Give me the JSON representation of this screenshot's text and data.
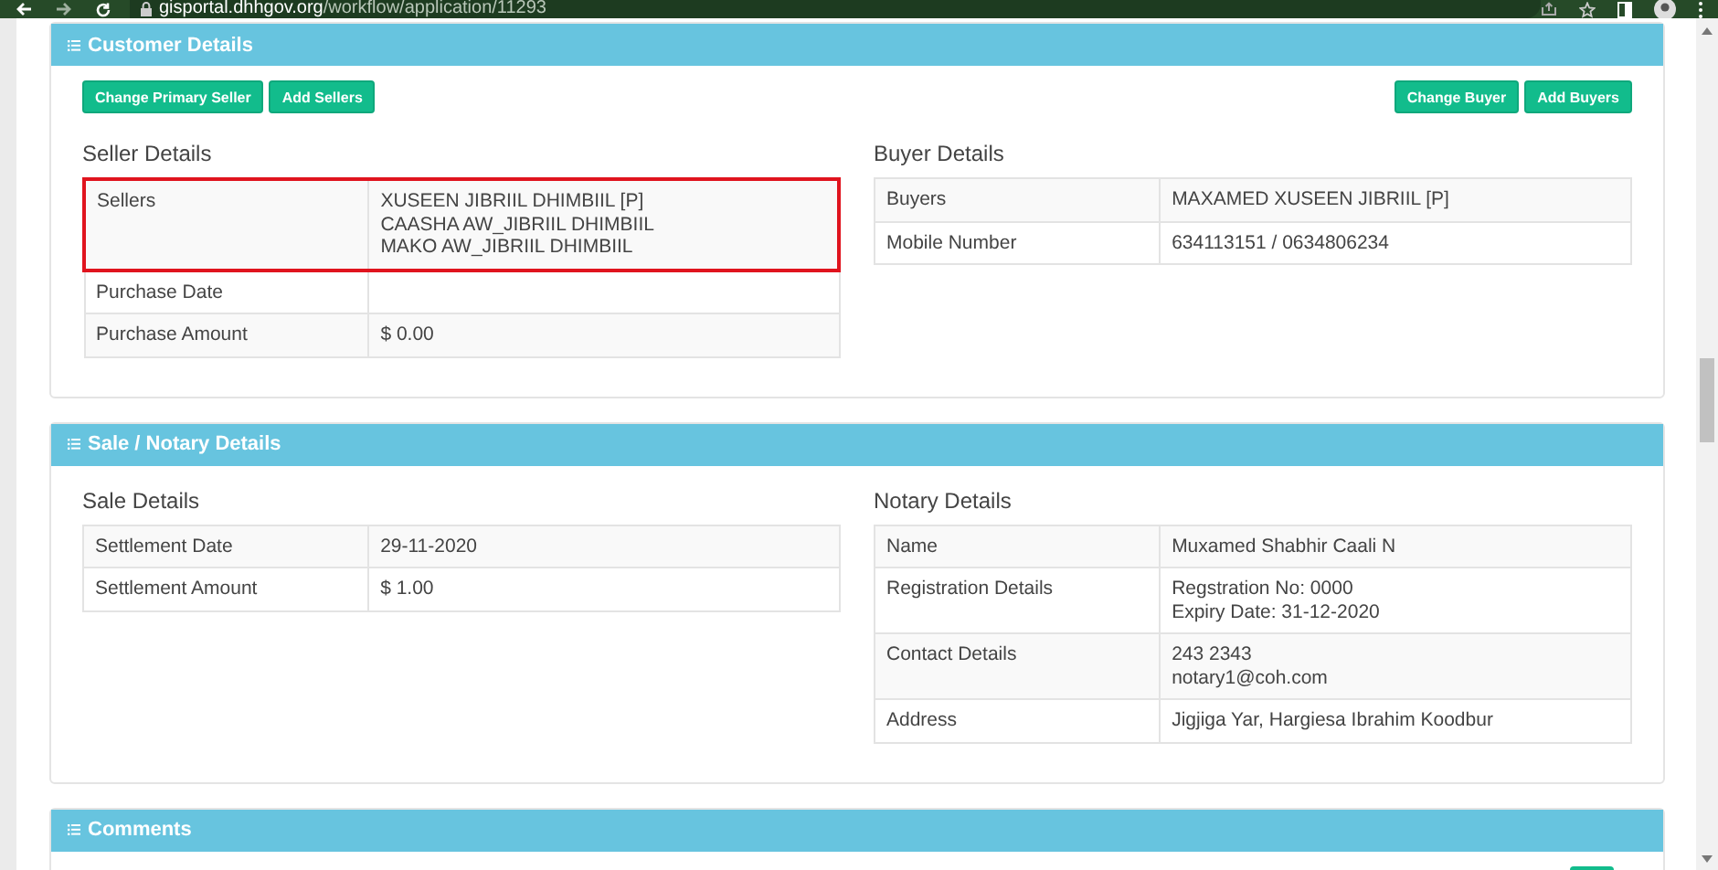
{
  "browser": {
    "url_host": "gisportal.dhhgov.org",
    "url_path": "/workflow/application/11293"
  },
  "panels": [
    {
      "title": "Customer Details",
      "columns": [
        {
          "buttons": [
            "Change Primary Seller",
            "Add Sellers"
          ],
          "heading": "Seller Details",
          "rows": [
            {
              "label": "Sellers",
              "lines": [
                "XUSEEN JIBRIIL DHIMBIIL [P]",
                "CAASHA AW_JIBRIIL DHIMBIIL",
                "MAKO AW_JIBRIIL DHIMBIIL"
              ],
              "highlighted": true
            },
            {
              "label": "Purchase Date",
              "highlighted": false
            },
            {
              "label": "Purchase Amount",
              "lines": [
                "$ 0.00"
              ],
              "highlighted": false
            }
          ]
        },
        {
          "buttons": [
            "Change Buyer",
            "Add Buyers"
          ],
          "heading": "Buyer Details",
          "rows": [
            {
              "label": "Buyers",
              "lines": [
                "MAXAMED XUSEEN JIBRIIL [P]"
              ],
              "highlighted": false
            },
            {
              "label": "Mobile Number",
              "lines": [
                "634113151 / 0634806234"
              ],
              "highlighted": false
            }
          ]
        }
      ]
    },
    {
      "title": "Sale / Notary Details",
      "columns": [
        {
          "heading": "Sale Details",
          "rows": [
            {
              "label": "Settlement Date",
              "lines": [
                "29-11-2020"
              ],
              "highlighted": false
            },
            {
              "label": "Settlement Amount",
              "lines": [
                "$ 1.00"
              ],
              "highlighted": false
            }
          ]
        },
        {
          "heading": "Notary Details",
          "rows": [
            {
              "label": "Name",
              "lines": [
                "Muxamed Shabhir Caali N"
              ],
              "highlighted": false
            },
            {
              "label": "Registration Details",
              "lines": [
                "Regstration No: 0000",
                "Expiry Date: 31-12-2020"
              ],
              "highlighted": false
            },
            {
              "label": "Contact Details",
              "lines": [
                "243 2343",
                "notary1@coh.com"
              ],
              "highlighted": false
            },
            {
              "label": "Address",
              "lines": [
                "Jigjiga Yar, Hargiesa Ibrahim Koodbur"
              ],
              "highlighted": false
            }
          ]
        }
      ]
    },
    {
      "title": "Comments",
      "actions": [
        {
          "kind": "button"
        }
      ]
    }
  ]
}
